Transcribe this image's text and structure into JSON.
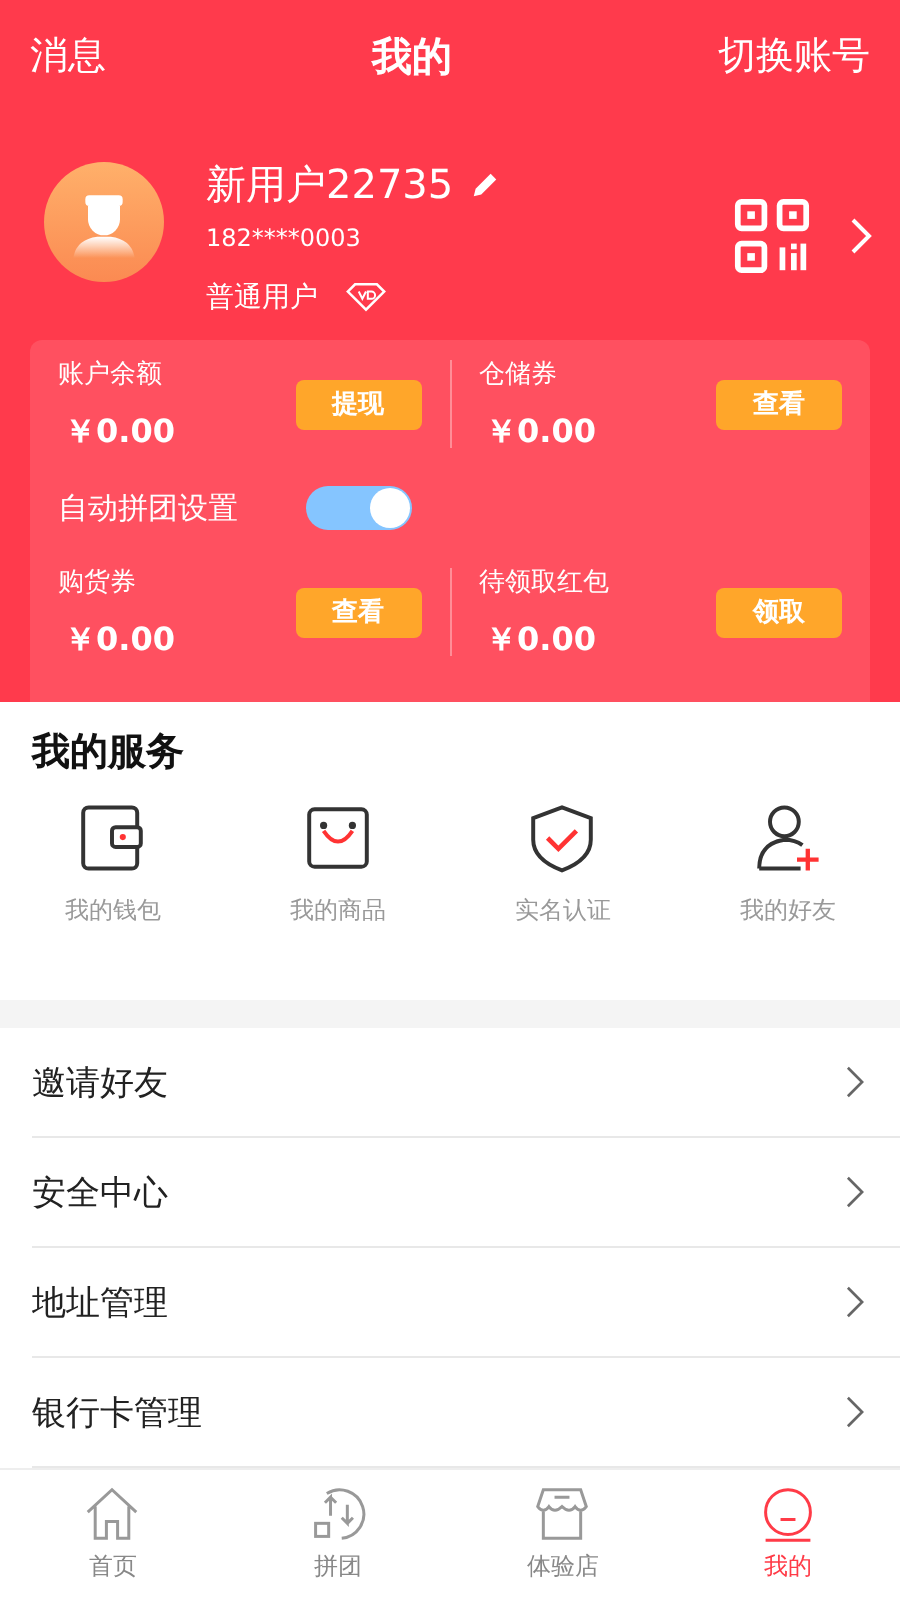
{
  "top_bar": {
    "left": "消息",
    "title": "我的",
    "right": "切换账号"
  },
  "profile": {
    "name": "新用户22735",
    "phone": "182****0003",
    "level": "普通用户"
  },
  "wallet": {
    "cells": [
      {
        "label": "账户余额",
        "amount": "￥0.00",
        "action": "提现"
      },
      {
        "label": "仓储券",
        "amount": "￥0.00",
        "action": "查看"
      }
    ],
    "toggle": {
      "label": "自动拼团设置",
      "on": true
    },
    "cells2": [
      {
        "label": "购货券",
        "amount": "￥0.00",
        "action": "查看"
      },
      {
        "label": "待领取红包",
        "amount": "￥0.00",
        "action": "领取"
      }
    ]
  },
  "services": {
    "title": "我的服务",
    "items": [
      {
        "kind": "wallet",
        "label": "我的钱包"
      },
      {
        "kind": "goods",
        "label": "我的商品"
      },
      {
        "kind": "shield",
        "label": "实名认证"
      },
      {
        "kind": "friend",
        "label": "我的好友"
      }
    ]
  },
  "menu": [
    "邀请好友",
    "安全中心",
    "地址管理",
    "银行卡管理"
  ],
  "tabs": [
    {
      "kind": "home",
      "label": "首页",
      "selected": false
    },
    {
      "kind": "group",
      "label": "拼团",
      "selected": false
    },
    {
      "kind": "store",
      "label": "体验店",
      "selected": false
    },
    {
      "kind": "me",
      "label": "我的",
      "selected": true
    }
  ]
}
